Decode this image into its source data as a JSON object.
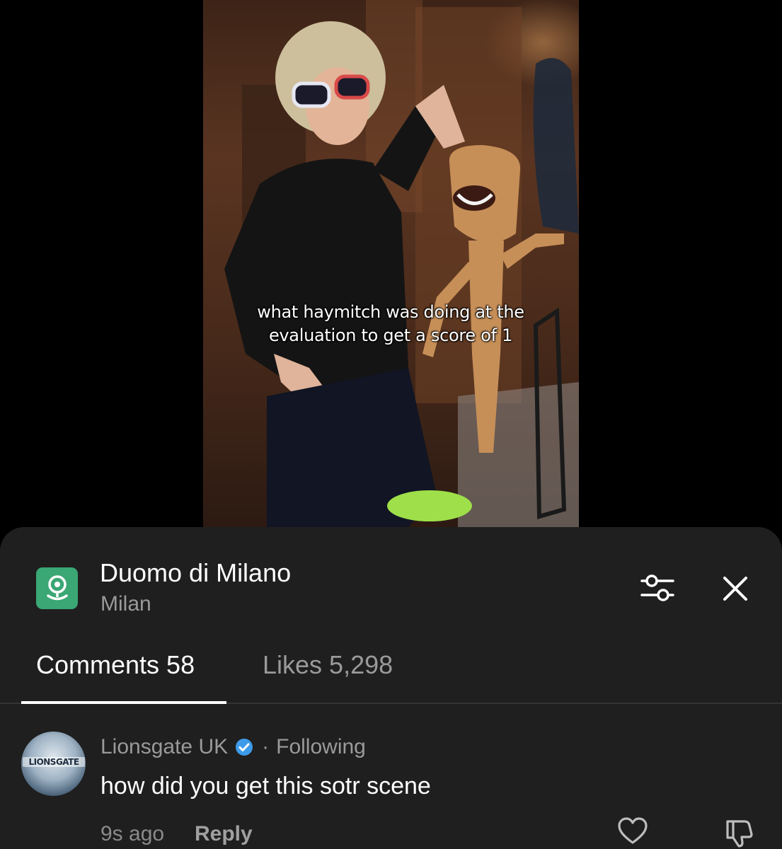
{
  "video": {
    "caption": "what haymitch was doing at the evaluation to get a score of 1"
  },
  "location": {
    "icon": "map-pin-icon",
    "name": "Duomo di Milano",
    "city": "Milan"
  },
  "header_actions": {
    "filter_icon": "sliders-icon",
    "close_icon": "close-icon"
  },
  "tabs": [
    {
      "label": "Comments 58",
      "active": true
    },
    {
      "label": "Likes 5,298",
      "active": false
    }
  ],
  "comment": {
    "avatar_text": "LIONSGATE",
    "author": "Lionsgate UK",
    "verified": true,
    "separator": "·",
    "follow_status": "Following",
    "text": "how did you get this sotr scene",
    "time": "9s ago",
    "reply_label": "Reply",
    "like_icon": "heart-icon",
    "dislike_icon": "thumbs-down-icon"
  },
  "colors": {
    "sheet_bg": "#1f1f1f",
    "location_icon_bg": "#3aa774",
    "verified_blue": "#3d9be9",
    "muted_text": "#9a9a9a"
  }
}
